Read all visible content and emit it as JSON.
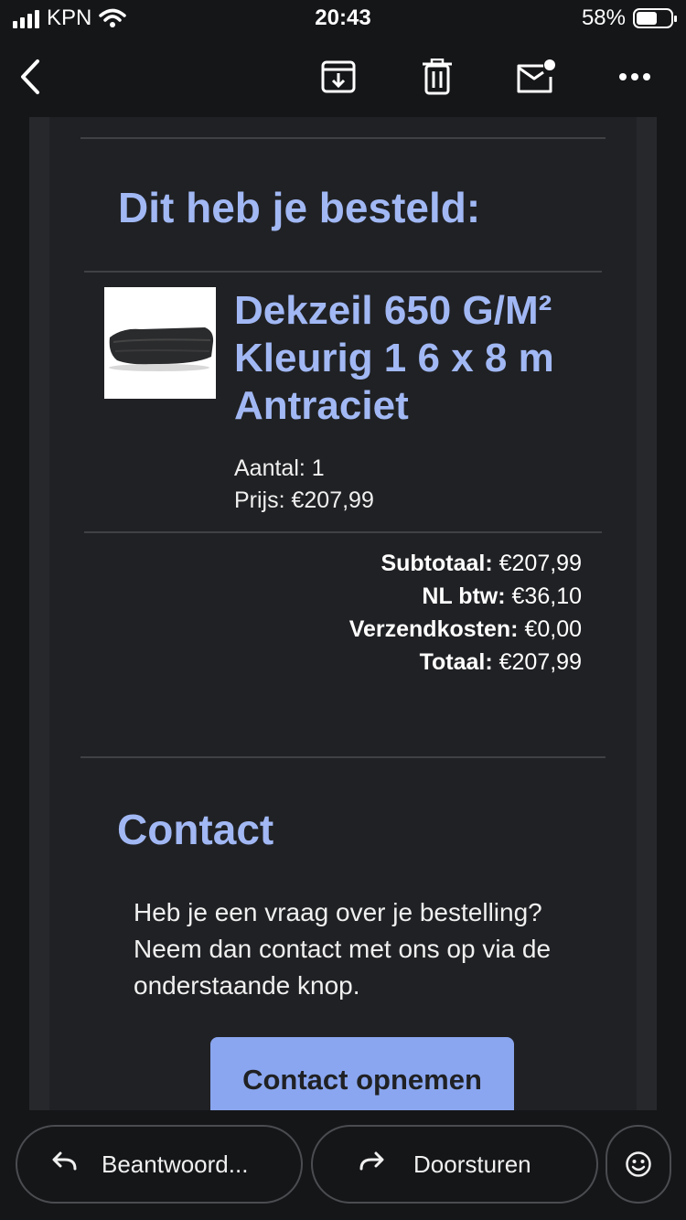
{
  "status": {
    "carrier": "KPN",
    "time": "20:43",
    "battery": "58%"
  },
  "toolbar": {
    "back_icon": "chevron-left-icon",
    "archive_icon": "archive-icon",
    "delete_icon": "trash-icon",
    "unread_icon": "mark-unread-icon",
    "more_icon": "more-icon"
  },
  "order": {
    "heading": "Dit heb je besteld:",
    "product": {
      "title": "Dekzeil 650 G/M² Kleurig 1 6 x 8 m Antraciet",
      "quantity": "Aantal: 1",
      "price": "Prijs: €207,99"
    },
    "totals": [
      {
        "label": "Subtotaal:",
        "value": "€207,99"
      },
      {
        "label": "NL btw:",
        "value": "€36,10"
      },
      {
        "label": "Verzendkosten:",
        "value": "€0,00"
      },
      {
        "label": "Totaal:",
        "value": "€207,99"
      }
    ]
  },
  "contact": {
    "heading": "Contact",
    "text": "Heb je een vraag over je bestelling? Neem dan contact met ons op via de onderstaande knop.",
    "button_label": "Contact opnemen"
  },
  "bottom": {
    "reply_label": "Beantwoord...",
    "forward_label": "Doorsturen",
    "emoji_icon": "emoji-icon"
  },
  "colors": {
    "accent": "#a1b8f4",
    "button": "#8aa6f0",
    "background": "#202124"
  }
}
